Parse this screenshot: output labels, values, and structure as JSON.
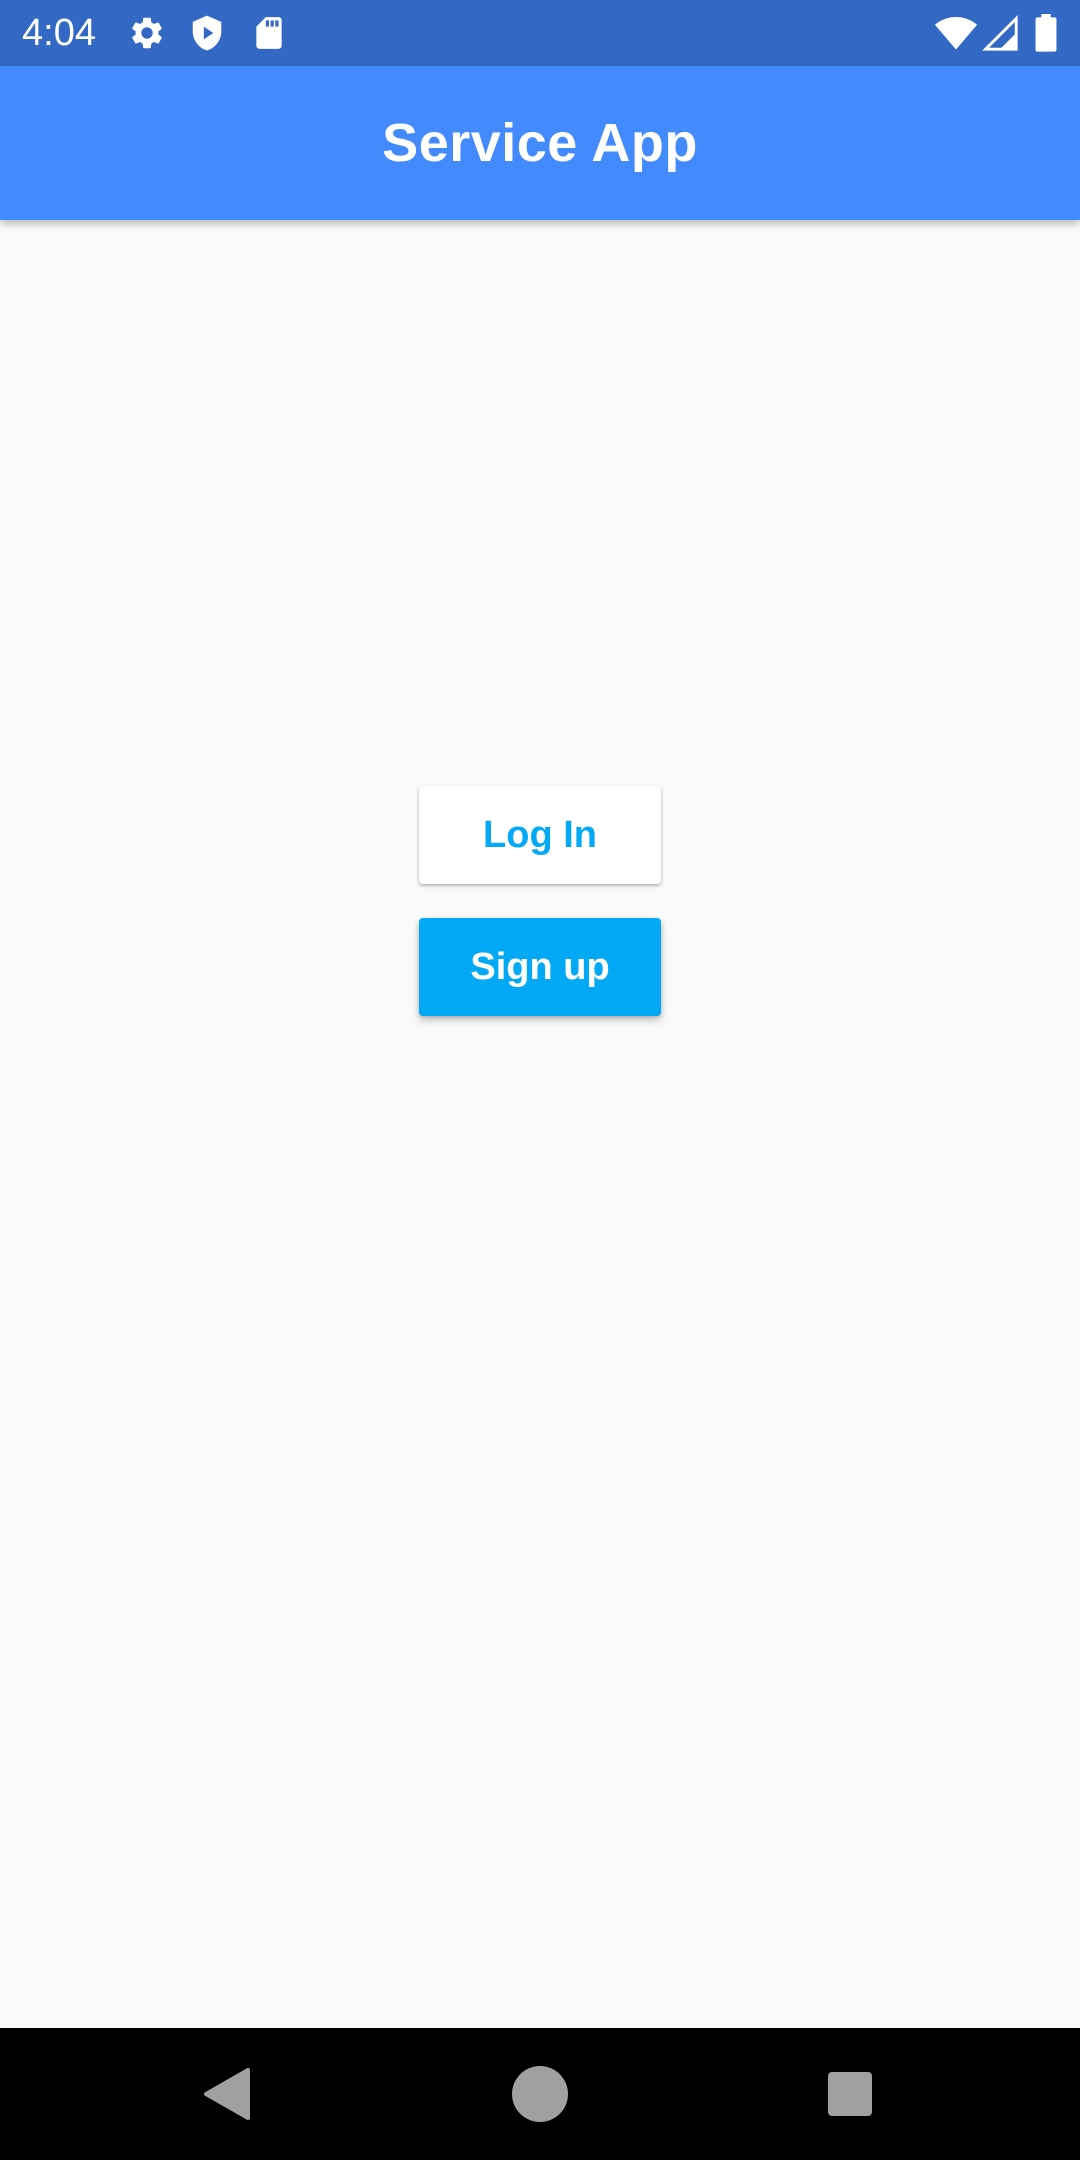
{
  "status_bar": {
    "time": "4:04",
    "background": "#3369c4",
    "left_icons": [
      "gear-icon",
      "shield-icon",
      "sd-card-icon"
    ],
    "right_icons": [
      "wifi-icon",
      "cell-signal-icon",
      "battery-icon"
    ]
  },
  "app_bar": {
    "title": "Service App",
    "background": "#448aff"
  },
  "main": {
    "login_label": "Log In",
    "signup_label": "Sign up",
    "accent": "#03a9f4"
  },
  "nav_bar": {
    "buttons": [
      "back-icon",
      "home-icon",
      "recents-icon"
    ]
  }
}
